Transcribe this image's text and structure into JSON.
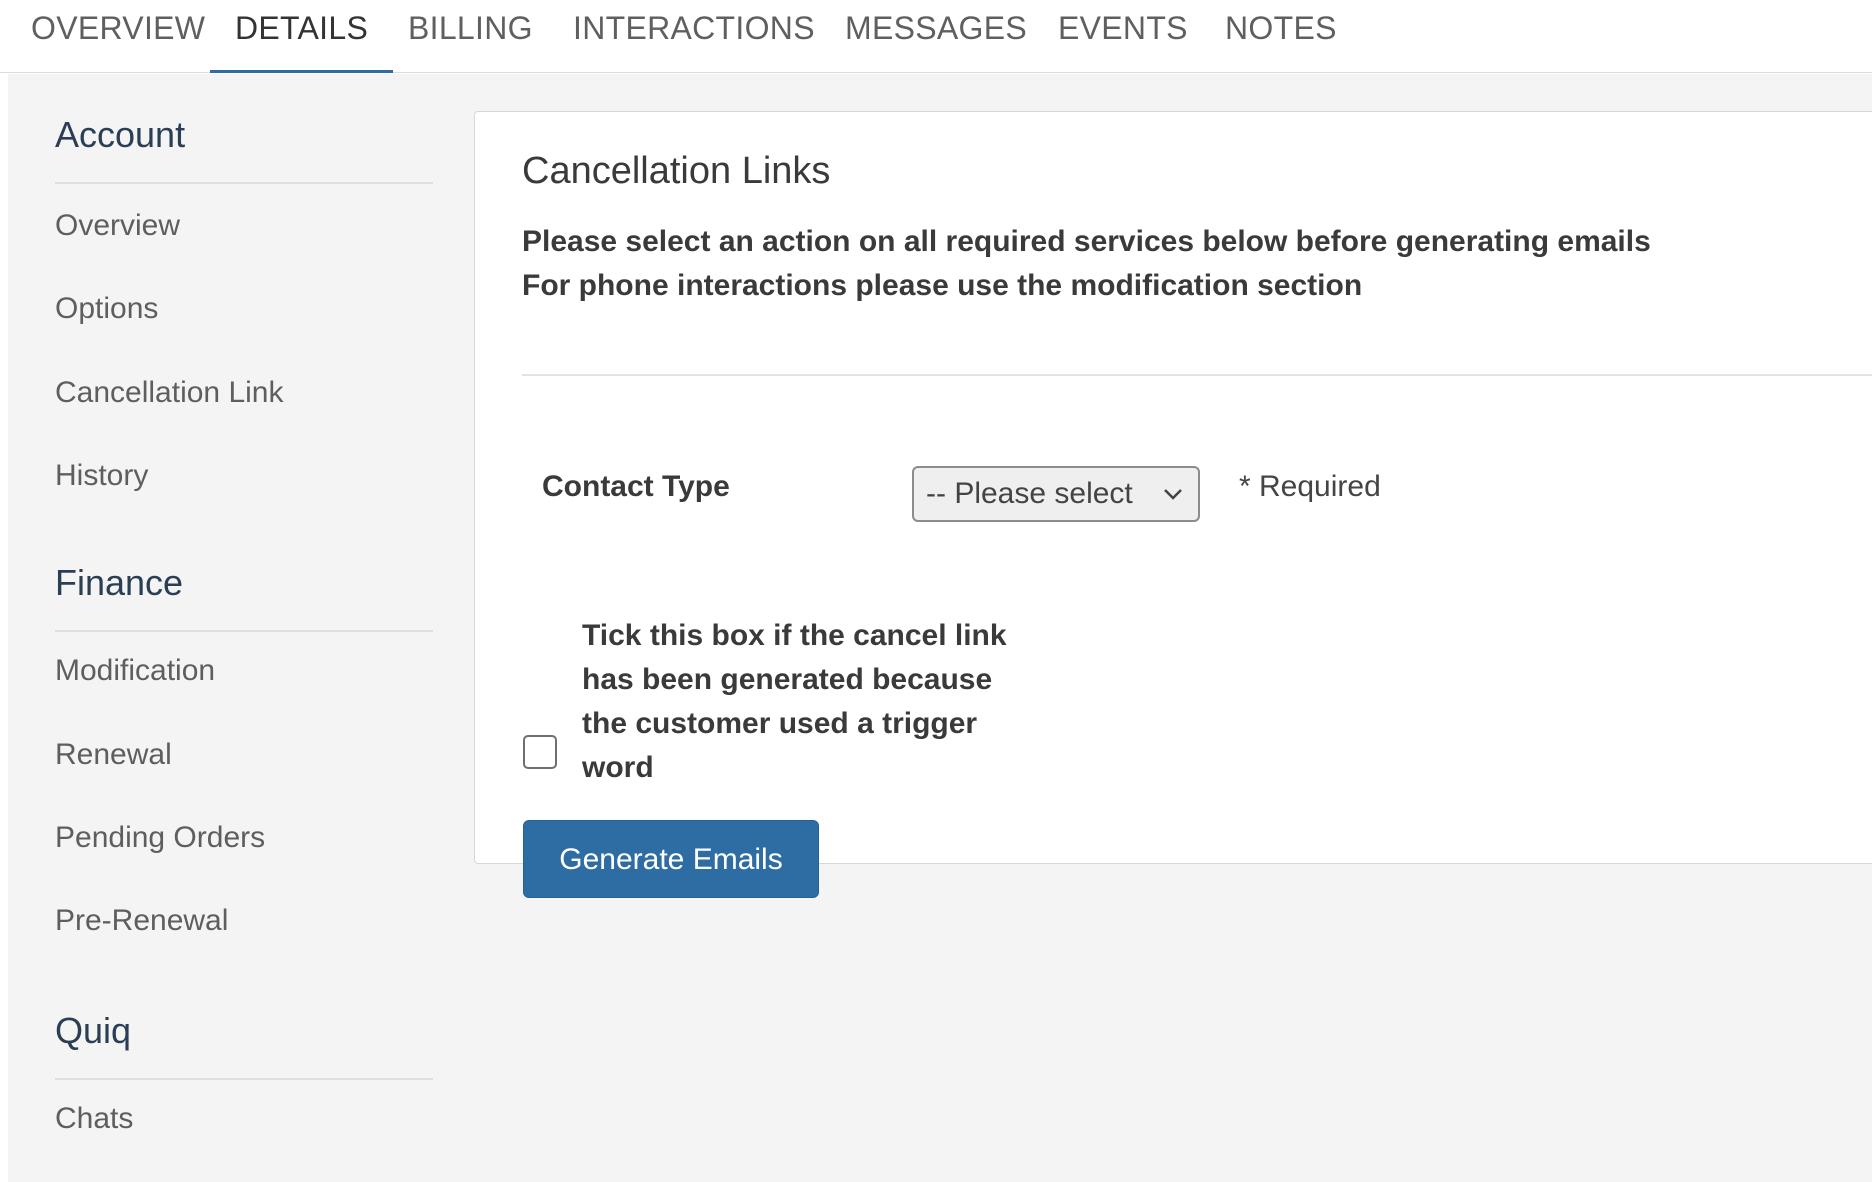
{
  "tabs": [
    {
      "label": "OVERVIEW"
    },
    {
      "label": "DETAILS",
      "active": true
    },
    {
      "label": "BILLING"
    },
    {
      "label": "INTERACTIONS"
    },
    {
      "label": "MESSAGES"
    },
    {
      "label": "EVENTS"
    },
    {
      "label": "NOTES"
    }
  ],
  "sidebar": {
    "sections": [
      {
        "title": "Account",
        "items": [
          "Overview",
          "Options",
          "Cancellation Link",
          "History"
        ]
      },
      {
        "title": "Finance",
        "items": [
          "Modification",
          "Renewal",
          "Pending Orders",
          "Pre-Renewal"
        ]
      },
      {
        "title": "Quiq",
        "items": [
          "Chats"
        ]
      }
    ]
  },
  "panel": {
    "title": "Cancellation Links",
    "notes": [
      "Please select an action on all required services below before generating emails",
      "For phone interactions please use the modification section"
    ],
    "contact_type_label": "Contact Type",
    "contact_type_select": "-- Please select",
    "required_text": "* Required",
    "checkbox_label": "Tick this box if the cancel link has been generated because the customer used a trigger word",
    "checkbox_checked": false,
    "generate_button": "Generate Emails"
  },
  "colors": {
    "accent": "#2e6da4",
    "background": "#f4f4f4",
    "sidebar_heading": "#2a3e55"
  }
}
